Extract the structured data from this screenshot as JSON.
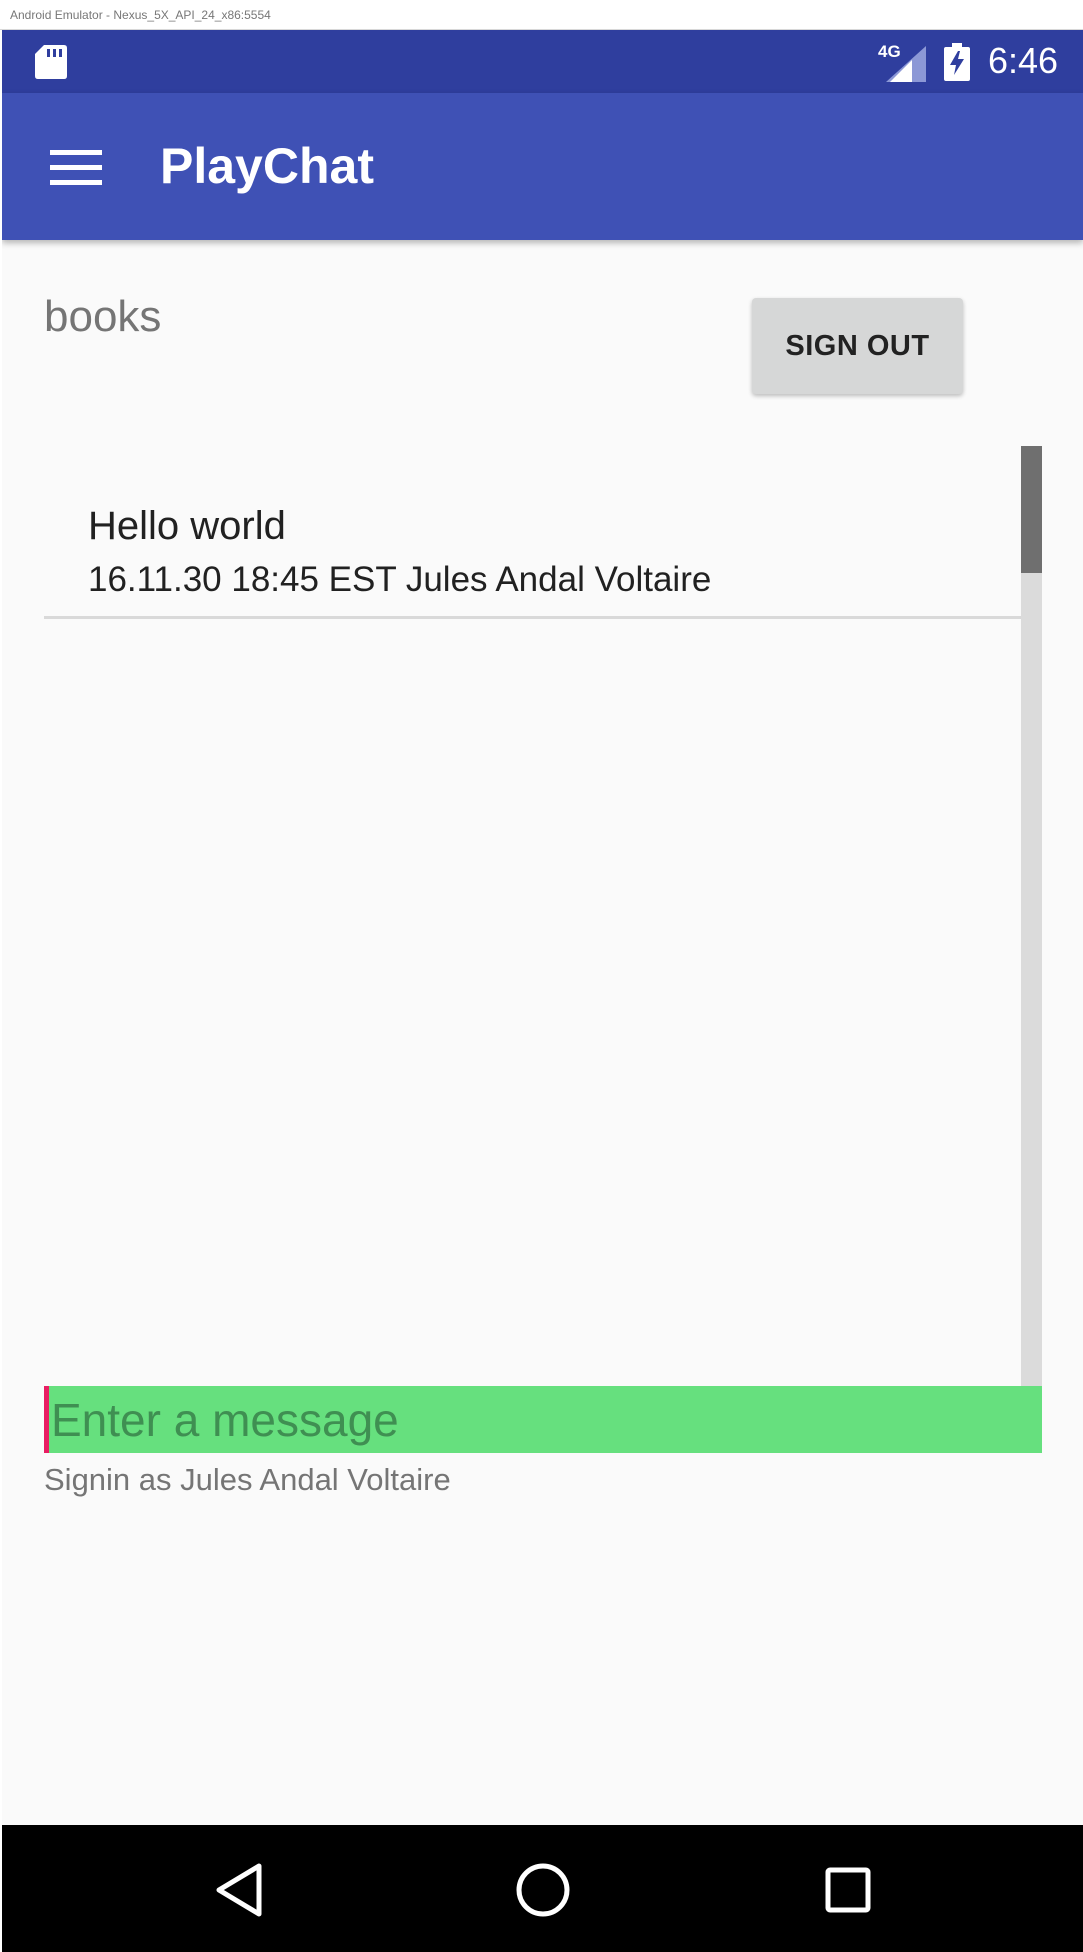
{
  "window": {
    "title": "Android Emulator - Nexus_5X_API_24_x86:5554"
  },
  "status_bar": {
    "left_icon": "sd-card-icon",
    "network_label": "4G",
    "signal_icon": "signal-icon",
    "battery_icon": "battery-charging-icon",
    "time": "6:46",
    "background_color": "#2f3e9e"
  },
  "app_bar": {
    "menu_icon": "hamburger-menu-icon",
    "title": "PlayChat",
    "background_color": "#3f51b5"
  },
  "channel": {
    "name": "books"
  },
  "actions": {
    "sign_out_label": "SIGN OUT"
  },
  "messages": [
    {
      "text": "Hello world",
      "meta": "16.11.30 18:45 EST Jules Andal Voltaire"
    }
  ],
  "composer": {
    "placeholder": "Enter a message",
    "highlight_color": "#66e07e",
    "cursor_color": "#e91e63"
  },
  "footer": {
    "signin_text": "Signin as Jules Andal Voltaire"
  },
  "nav_bar": {
    "back_icon": "back-triangle-icon",
    "home_icon": "home-circle-icon",
    "recents_icon": "recents-square-icon"
  }
}
